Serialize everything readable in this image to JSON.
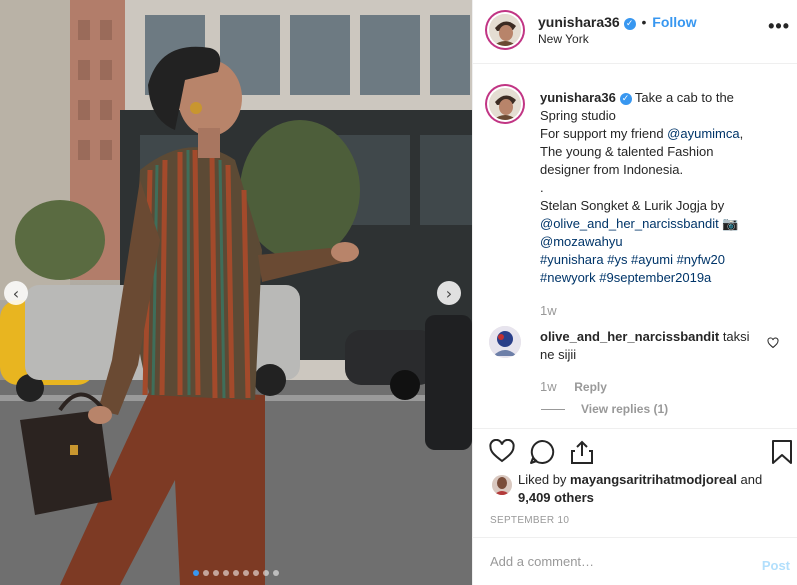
{
  "post": {
    "username": "yunishara36",
    "verified_glyph": "✓",
    "follow_separator": "•",
    "follow_label": "Follow",
    "location": "New York",
    "more_glyph": "•••",
    "caption_lines": [
      "Take a cab to the",
      "Spring studio",
      "For support my friend ",
      "@ayumimca",
      ",",
      "The young & talented Fashion",
      "designer from Indonesia.",
      ".",
      "Stelan Songket & Lurik Jogja by",
      "@olive_and_her_narcissbandit",
      "📷",
      "@mozawahyu",
      "#yunishara #ys #ayumi #nyfw20",
      "#newyork #9september2019a"
    ],
    "caption_time": "1w",
    "comment": {
      "username": "olive_and_her_narcissbandit",
      "text_1": "taksi",
      "text_2": "ne sijii",
      "time": "1w",
      "reply_label": "Reply",
      "view_replies": "View replies (1)"
    },
    "likes": {
      "prefix": "Liked by ",
      "liker": "mayangsaritrihatmodjoreal",
      "and": " and",
      "others": "9,409 others"
    },
    "date": "SEPTEMBER 10",
    "comment_placeholder": "Add a comment…",
    "post_label": "Post",
    "carousel": {
      "prev_glyph": "‹",
      "next_glyph": "›",
      "dots": 9,
      "active_index": 0
    }
  },
  "icons": [
    "heart-icon",
    "comment-icon",
    "share-icon",
    "bookmark-icon",
    "verified-badge-icon",
    "chevron-left-icon",
    "chevron-right-icon",
    "camera-emoji-icon"
  ],
  "colors": {
    "link": "#003569",
    "accent": "#3897f0",
    "muted": "#999999",
    "text": "#262626",
    "post_disabled": "#b2dffc"
  }
}
